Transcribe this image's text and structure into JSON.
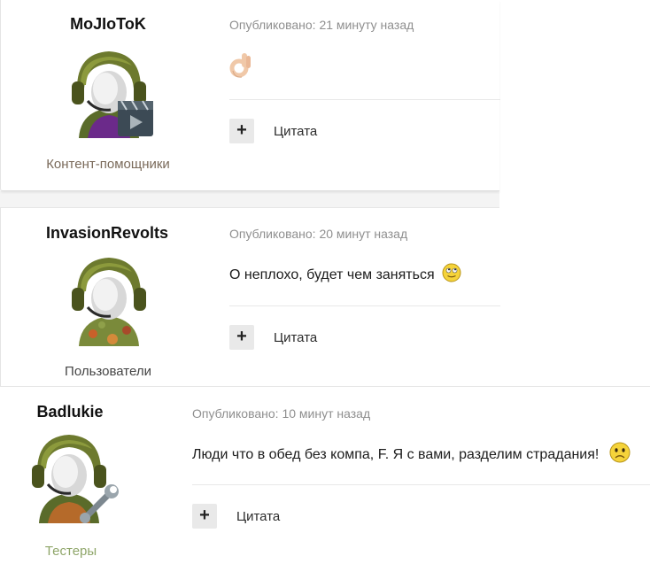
{
  "posts": [
    {
      "author": "MoJIoToK",
      "group": "Контент-помощники",
      "group_color": "#7a6a5a",
      "published": "Опубликовано: 21 минуту назад",
      "text": "",
      "emoji": "ok-hand-icon",
      "quote_label": "Цитата",
      "avatar_badge": "film-clapper"
    },
    {
      "author": "InvasionRevolts",
      "group": "Пользователи",
      "group_color": "#444444",
      "published": "Опубликовано: 20 минут назад",
      "text": "О неплохо, будет чем заняться",
      "emoji": "rolling-eyes-smiley-icon",
      "quote_label": "Цитата",
      "avatar_badge": "camouflage"
    },
    {
      "author": "Badlukie",
      "group": "Тестеры",
      "group_color": "#8fa66a",
      "published": "Опубликовано: 10 минут назад",
      "text": "Люди что в обед без компа, F. Я с вами, разделим страдания!",
      "emoji": "sad-smiley-icon",
      "quote_label": "Цитата",
      "avatar_badge": "wrench"
    }
  ],
  "plus_symbol": "+"
}
